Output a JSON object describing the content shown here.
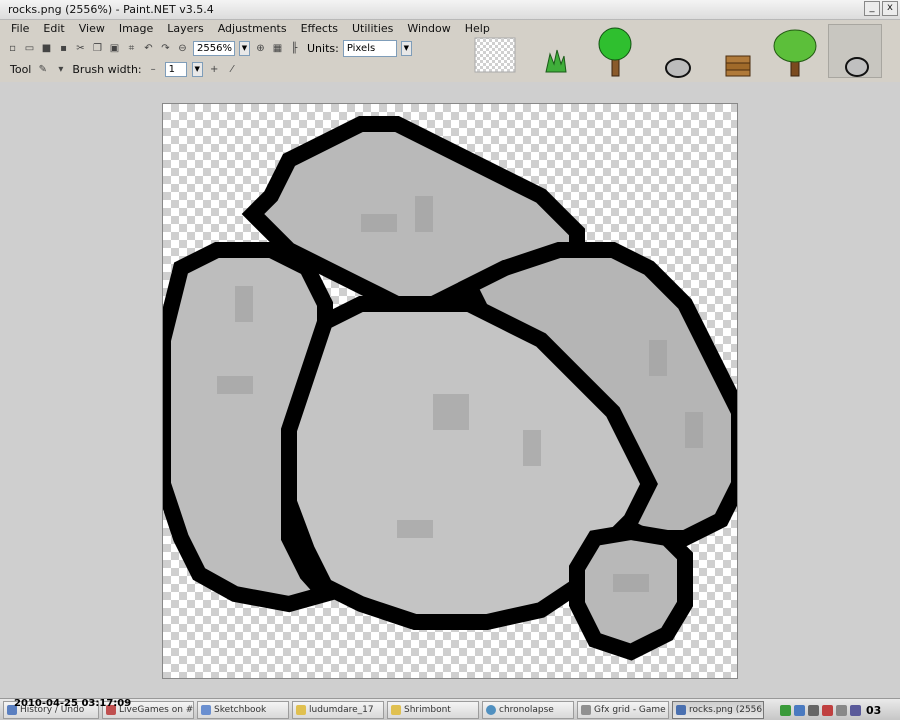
{
  "window": {
    "title": "rocks.png (2556%) - Paint.NET v3.5.4",
    "minimize": "_",
    "close": "x"
  },
  "menu": [
    "File",
    "Edit",
    "View",
    "Image",
    "Layers",
    "Adjustments",
    "Effects",
    "Utilities",
    "Window",
    "Help"
  ],
  "toolbar": {
    "zoom_value": "2556%",
    "units_label": "Units:",
    "units_value": "Pixels"
  },
  "toolbar2": {
    "tool_label": "Tool",
    "brush_width_label": "Brush width:",
    "brush_width_value": "1"
  },
  "thumbnails": [
    "blank",
    "grass",
    "tree-large",
    "rock-small",
    "log-pile",
    "tree",
    "rocks"
  ],
  "overlay": {
    "timestamp": "2010-04-25 03:17:09"
  },
  "taskbar": {
    "items": [
      "History / Undo",
      "LiveGames on #b...",
      "Sketchbook",
      "ludumdare_17",
      "Shrimbont",
      "chronolapse",
      "Gfx grid - Game ...",
      "rocks.png (2556..."
    ],
    "clock": "03"
  },
  "colors": {
    "accent": "#7f9db9",
    "rock_outline": "#000000",
    "rock_fill": "#bdbdbd"
  }
}
